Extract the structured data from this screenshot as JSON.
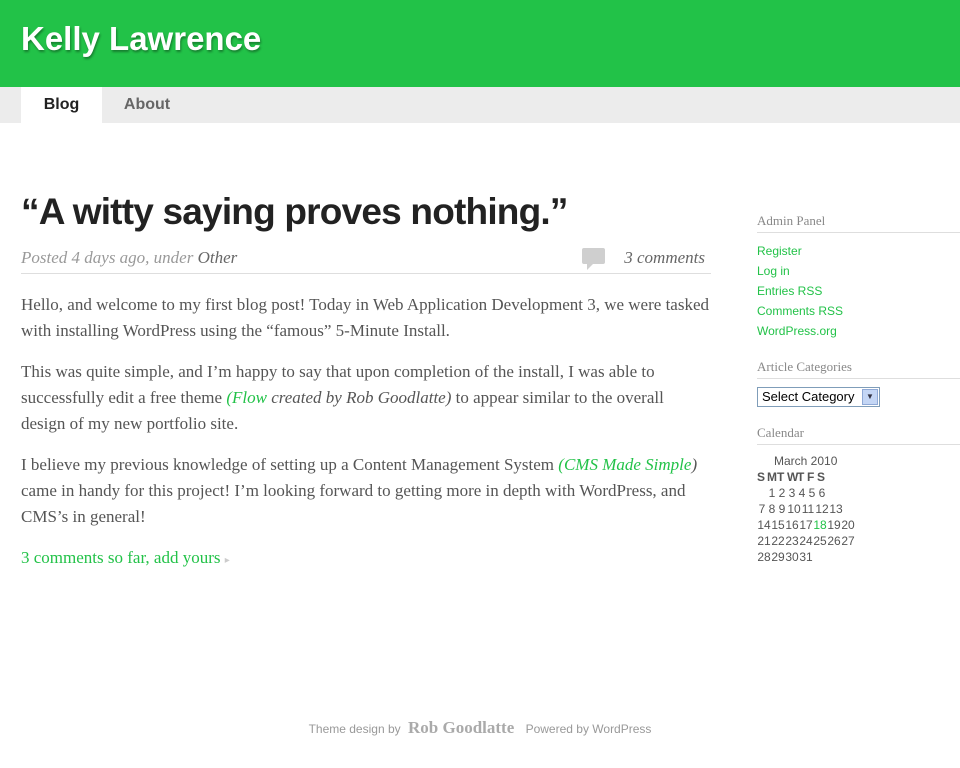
{
  "site": {
    "title": "Kelly Lawrence"
  },
  "nav": {
    "tabs": [
      {
        "label": "Blog"
      },
      {
        "label": "About"
      }
    ]
  },
  "post": {
    "title": "“A witty saying proves nothing.”",
    "meta_prefix": "Posted 4 days ago, under",
    "category": "Other",
    "comments": "3 comments",
    "p1": "Hello, and welcome to my first blog post! Today in Web Application Development 3, we were tasked with installing WordPress using the “famous” 5-Minute Install.",
    "p2_start": "This was quite simple, and I’m happy to say that upon completion of the install, I was able to successfully edit a free theme ",
    "p2_link": "Flow",
    "p2_credit": " created by Rob Goodlatte)",
    "p2_end": " to appear similar to the overall design of my new portfolio site.",
    "p3_start": "I believe my previous knowledge of setting up a Content Management System ",
    "p3_link": "CMS Made Simple",
    "p3_end": " came in handy for this project! I’m looking forward to getting more in depth with WordPress, and CMS’s in general!",
    "more_link": "3 comments so far, add yours"
  },
  "sidebar": {
    "admin_title": "Admin Panel",
    "admin_links": [
      "Register",
      "Log in",
      "Entries RSS",
      "Comments RSS",
      "WordPress.org"
    ],
    "categories_title": "Article Categories",
    "categories_select": "Select Category",
    "calendar_title": "Calendar",
    "calendar_caption": "March 2010",
    "calendar_head": [
      "S",
      "M",
      "T",
      "W",
      "T",
      "F",
      "S"
    ],
    "calendar_rows": [
      [
        "",
        "1",
        "2",
        "3",
        "4",
        "5",
        "6"
      ],
      [
        "7",
        "8",
        "9",
        "10",
        "11",
        "12",
        "13"
      ],
      [
        "14",
        "15",
        "16",
        "17",
        "18",
        "19",
        "20"
      ],
      [
        "21",
        "22",
        "23",
        "24",
        "25",
        "26",
        "27"
      ],
      [
        "28",
        "29",
        "30",
        "31",
        "",
        "",
        ""
      ]
    ],
    "calendar_today": "18"
  },
  "footer": {
    "theme_prefix": "Theme design by",
    "author": "Rob Goodlatte",
    "powered": "Powered by WordPress"
  },
  "colors": {
    "brand": "#22c248",
    "nav_bg": "#ececec"
  }
}
